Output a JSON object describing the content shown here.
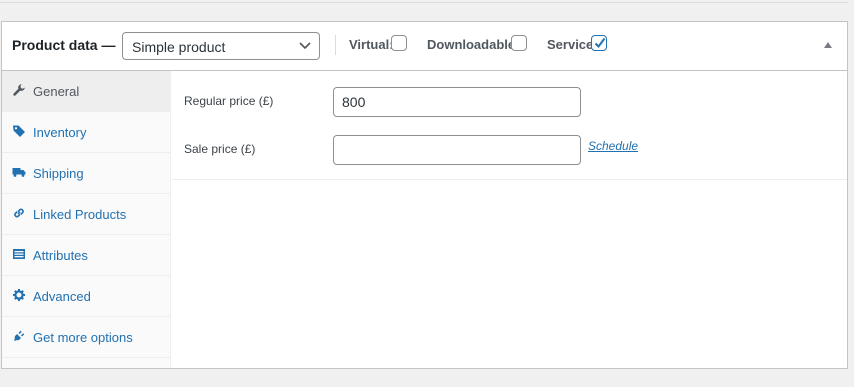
{
  "header": {
    "title": "Product data —",
    "product_type": {
      "selected": "Simple product"
    },
    "options": [
      {
        "label": "Virtual:",
        "checked": false
      },
      {
        "label": "Downloadable:",
        "checked": false
      },
      {
        "label": "Service:",
        "checked": true
      }
    ]
  },
  "tabs": [
    {
      "label": "General",
      "icon": "wrench-icon",
      "active": true
    },
    {
      "label": "Inventory",
      "icon": "tag-icon",
      "active": false
    },
    {
      "label": "Shipping",
      "icon": "truck-icon",
      "active": false
    },
    {
      "label": "Linked Products",
      "icon": "link-icon",
      "active": false
    },
    {
      "label": "Attributes",
      "icon": "list-icon",
      "active": false
    },
    {
      "label": "Advanced",
      "icon": "gear-icon",
      "active": false
    },
    {
      "label": "Get more options",
      "icon": "plug-icon",
      "active": false
    }
  ],
  "general": {
    "regular_price": {
      "label": "Regular price (£)",
      "value": "800"
    },
    "sale_price": {
      "label": "Sale price (£)",
      "value": ""
    },
    "schedule_link": "Schedule"
  },
  "colors": {
    "link": "#2271b1",
    "border": "#c3c4c7",
    "tab_active_bg": "#eeeeee"
  }
}
